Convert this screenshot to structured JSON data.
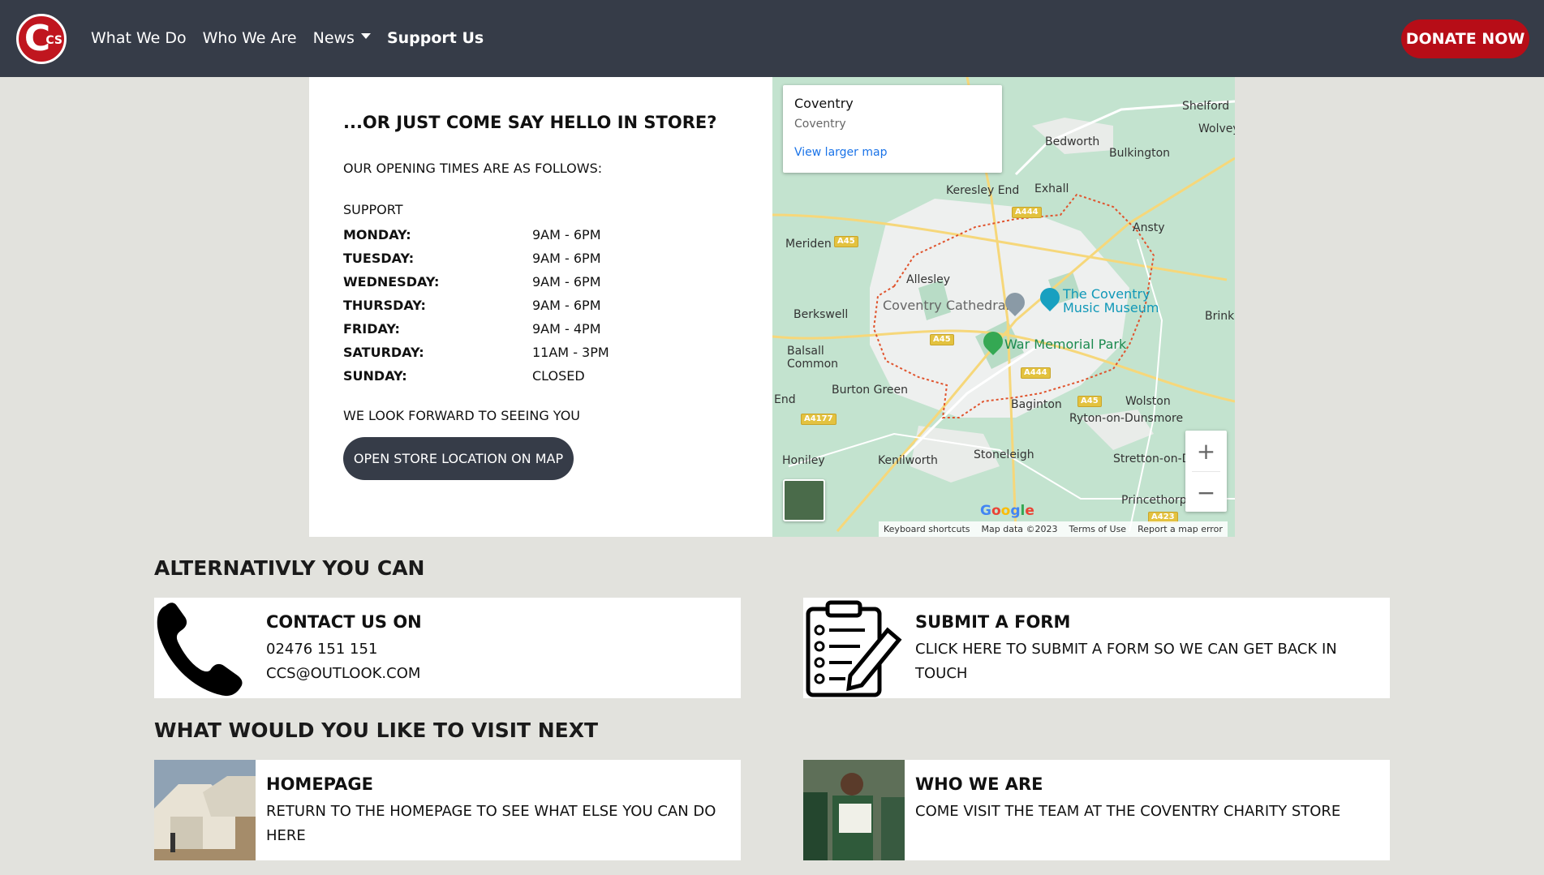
{
  "nav": {
    "logo_letter": "C",
    "logo_sub": "CS",
    "links": [
      "What We Do",
      "Who We Are",
      "News",
      "Support Us"
    ],
    "donate": "DONATE NOW"
  },
  "store": {
    "heading": "...OR JUST COME SAY HELLO IN STORE?",
    "subheading": "OUR OPENING TIMES ARE AS FOLLOWS:",
    "hours_title": "SUPPORT",
    "hours": [
      {
        "day": "MONDAY:",
        "time": "9AM - 6PM"
      },
      {
        "day": "TUESDAY:",
        "time": "9AM - 6PM"
      },
      {
        "day": "WEDNESDAY:",
        "time": "9AM - 6PM"
      },
      {
        "day": "THURSDAY:",
        "time": "9AM - 6PM"
      },
      {
        "day": "FRIDAY:",
        "time": "9AM - 4PM"
      },
      {
        "day": "SATURDAY:",
        "time": "11AM - 3PM"
      },
      {
        "day": "SUNDAY:",
        "time": "CLOSED"
      }
    ],
    "closing": "WE LOOK FORWARD TO SEEING YOU",
    "map_button": "OPEN STORE LOCATION ON MAP"
  },
  "map": {
    "info_title": "Coventry",
    "info_sub": "Coventry",
    "info_link": "View larger map",
    "places": {
      "shelford": "Shelford",
      "wolvey": "Wolvey",
      "bedworth": "Bedworth",
      "bulkington": "Bulkington",
      "keresley": "Keresley End",
      "exhall": "Exhall",
      "ansty": "Ansty",
      "meriden": "Meriden",
      "allesley": "Allesley",
      "berkswell": "Berkswell",
      "brinkl": "Brinkl",
      "balsall": "Balsall\nCommon",
      "burton": "Burton Green",
      "end": "End",
      "baginton": "Baginton",
      "wolston": "Wolston",
      "ryton": "Ryton-on-Dunsmore",
      "honiley": "Honiley",
      "kenilworth": "Kenilworth",
      "stoneleigh": "Stoneleigh",
      "stretton": "Stretton-on-D",
      "princethorp": "Princethorp",
      "cathedral": "Coventry Cathedral",
      "museum": "The Coventry\nMusic Museum",
      "park": "War Memorial Park"
    },
    "roads": [
      "A444",
      "A45",
      "A45",
      "A444",
      "A45",
      "A4177",
      "A423"
    ],
    "google": [
      "G",
      "o",
      "o",
      "g",
      "l",
      "e"
    ],
    "footer": [
      "Keyboard shortcuts",
      "Map data ©2023",
      "Terms of Use",
      "Report a map error"
    ],
    "zoom_in": "+",
    "zoom_out": "−"
  },
  "alt": {
    "title": "ALTERNATIVLY YOU CAN",
    "contact": {
      "title": "CONTACT US ON",
      "phone": "02476 151 151",
      "email": "CCS@OUTLOOK.COM"
    },
    "form": {
      "title": "SUBMIT A FORM",
      "desc": "CLICK HERE TO SUBMIT A FORM SO WE CAN GET BACK IN TOUCH"
    }
  },
  "visit": {
    "title": "WHAT WOULD YOU LIKE TO VISIT NEXT",
    "home": {
      "title": "HOMEPAGE",
      "desc": "RETURN TO THE HOMEPAGE TO SEE WHAT ELSE YOU CAN DO HERE"
    },
    "who": {
      "title": "WHO WE ARE",
      "desc": "COME VISIT THE TEAM AT THE COVENTRY CHARITY STORE"
    }
  }
}
